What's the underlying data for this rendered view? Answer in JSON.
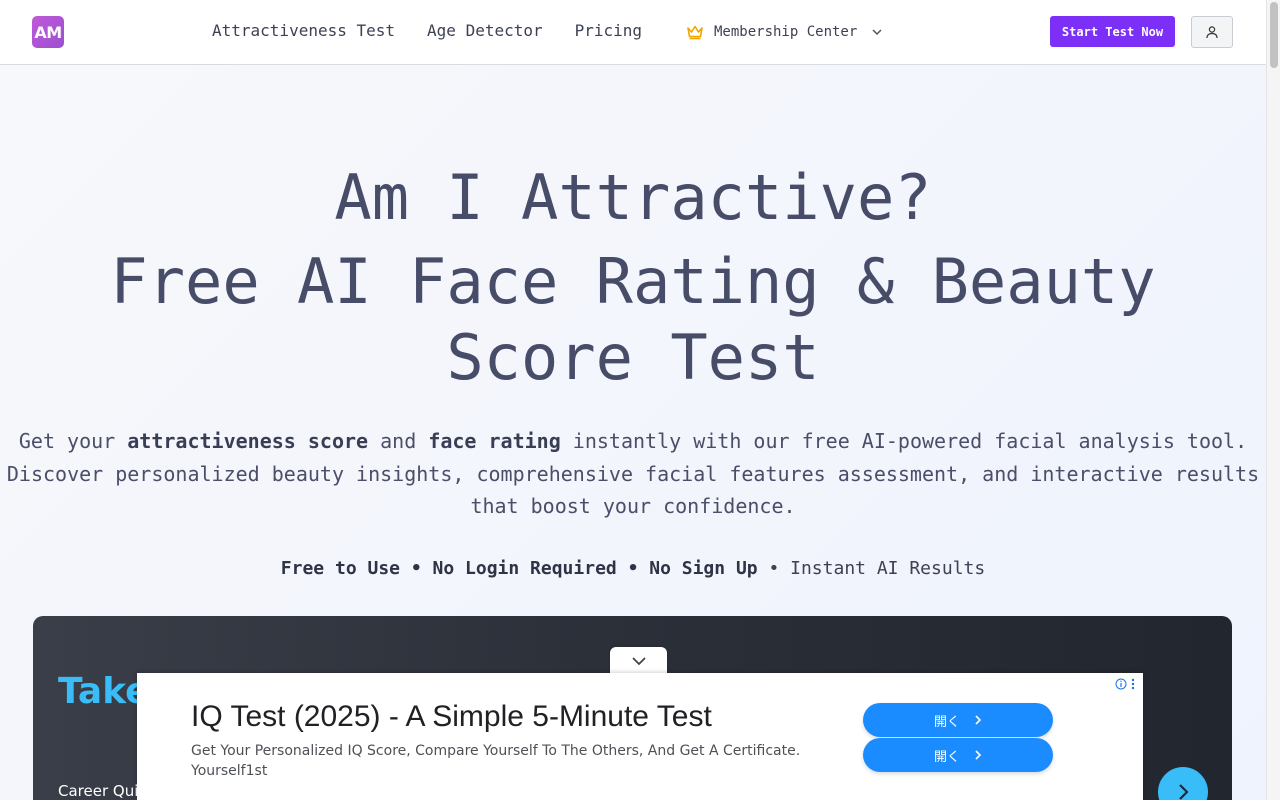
{
  "header": {
    "logo_text": "AM",
    "nav": [
      "Attractiveness Test",
      "Age Detector",
      "Pricing"
    ],
    "membership_label": "Membership Center",
    "start_button": "Start Test Now",
    "accent_color": "#7b2ff7"
  },
  "hero": {
    "title_line1": "Am I Attractive?",
    "title_line2": "Free AI Face Rating & Beauty Score Test",
    "desc_p1": "Get your ",
    "desc_b1": "attractiveness score",
    "desc_p2": " and ",
    "desc_b2": "face rating",
    "desc_p3": " instantly with our free AI-powered facial analysis tool. Discover personalized beauty insights, comprehensive facial features assessment, and interactive results that boost your confidence.",
    "features_bold": "Free to Use • No Login Required • No Sign Up",
    "features_tail": " • Instant AI Results"
  },
  "card": {
    "title": "Take",
    "subtitle": "Career Qui",
    "accent_color": "#38bdf8"
  },
  "ad": {
    "headline": "IQ Test (2025) - A Simple 5-Minute Test",
    "body": "Get Your Personalized IQ Score, Compare Yourself To The Others, And Get A Certificate.",
    "advertiser": "Yourself1st",
    "button1": "開く",
    "button2": "開く",
    "button_color": "#1a8cff"
  }
}
